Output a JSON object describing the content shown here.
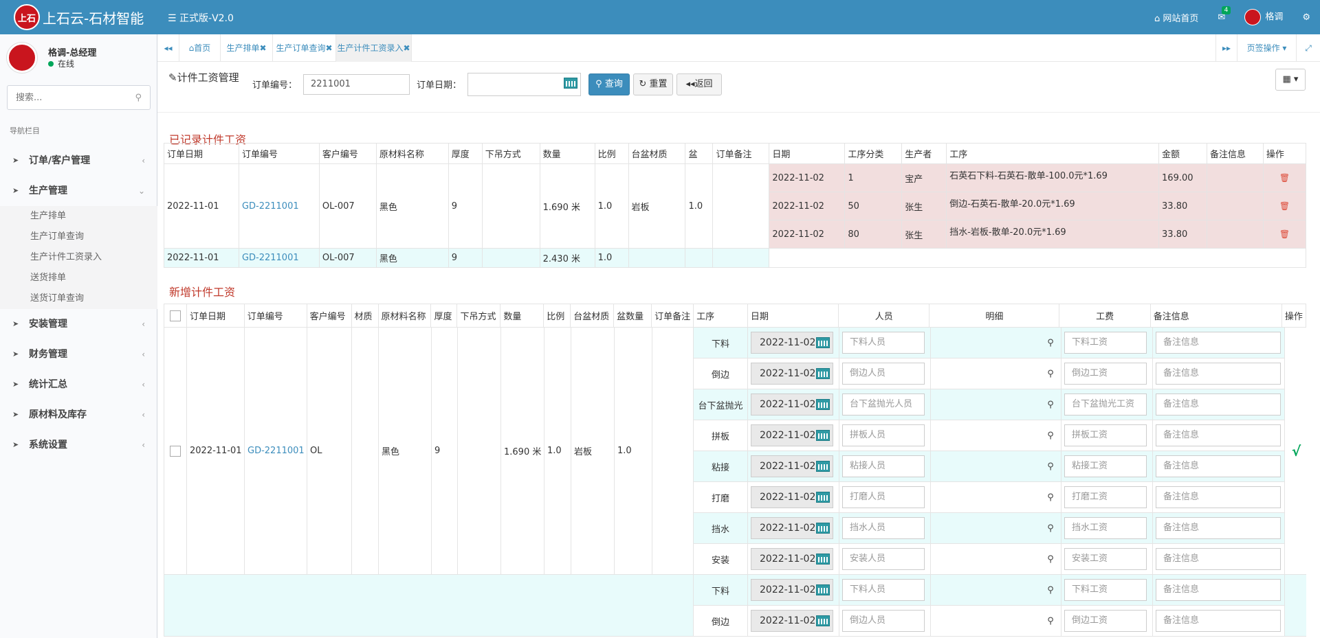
{
  "app": {
    "title": "上石云-石材智能",
    "logo_text": "上石",
    "version_label": "正式版-V2.0"
  },
  "topnav": {
    "home_label": "网站首页",
    "mail_badge": "4",
    "user_name": "格调"
  },
  "sidebar": {
    "user_name": "格调-总经理",
    "status": "在线",
    "search_placeholder": "搜索...",
    "nav_header": "导航栏目",
    "menu": [
      {
        "label": "订单/客户管理",
        "chev": "‹"
      },
      {
        "label": "生产管理",
        "chev": "⌄"
      },
      {
        "label": "安装管理",
        "chev": "‹"
      },
      {
        "label": "财务管理",
        "chev": "‹"
      },
      {
        "label": "统计汇总",
        "chev": "‹"
      },
      {
        "label": "原材料及库存",
        "chev": "‹"
      },
      {
        "label": "系统设置",
        "chev": "‹"
      }
    ],
    "submenu": [
      "生产排单",
      "生产订单查询",
      "生产计件工资录入",
      "送货排单",
      "送货订单查询"
    ]
  },
  "tabs": {
    "home": "首页",
    "t1": "生产排单",
    "t2": "生产订单查询",
    "t3": "生产计件工资录入",
    "page_ops": "页签操作"
  },
  "filter": {
    "title": "计件工资管理",
    "order_no_label": "订单编号：",
    "order_no_value": "2211001",
    "order_date_label": "订单日期：",
    "query_btn": "查询",
    "reset_btn": "重置",
    "back_btn": "返回"
  },
  "recorded": {
    "title": "已记录计件工资",
    "headers": [
      "订单日期",
      "订单编号",
      "客户编号",
      "原材料名称",
      "厚度",
      "下吊方式",
      "数量",
      "比例",
      "台盆材质",
      "盆",
      "订单备注",
      "日期",
      "工序分类",
      "生产者",
      "工序",
      "金额",
      "备注信息",
      "操作"
    ],
    "row1": {
      "order_date": "2022-11-01",
      "order_no": "GD-2211001",
      "cust": "OL-007",
      "material": "黑色",
      "thick": "9",
      "hang": "",
      "qty": "1.690 米",
      "ratio": "1.0",
      "basin_mat": "岩板",
      "basin": "1.0",
      "remark": ""
    },
    "entries": [
      {
        "date": "2022-11-02",
        "cat": "1",
        "worker": "宝产",
        "proc": "石英石下料-石英石-散单-100.0元*1.69",
        "amount": "169.00"
      },
      {
        "date": "2022-11-02",
        "cat": "50",
        "worker": "张生",
        "proc": "倒边-石英石-散单-20.0元*1.69",
        "amount": "33.80"
      },
      {
        "date": "2022-11-02",
        "cat": "80",
        "worker": "张生",
        "proc": "挡水-岩板-散单-20.0元*1.69",
        "amount": "33.80"
      }
    ],
    "row2": {
      "order_date": "2022-11-01",
      "order_no": "GD-2211001",
      "cust": "OL-007",
      "material": "黑色",
      "thick": "9",
      "qty": "2.430 米",
      "ratio": "1.0"
    }
  },
  "new": {
    "title": "新增计件工资",
    "headers": [
      "订单日期",
      "订单编号",
      "客户编号",
      "材质",
      "原材料名称",
      "厚度",
      "下吊方式",
      "数量",
      "比例",
      "台盆材质",
      "盆数量",
      "订单备注",
      "工序",
      "日期",
      "人员",
      "明细",
      "工费",
      "备注信息",
      "操作"
    ],
    "row": {
      "order_date": "2022-11-01",
      "order_no": "GD-2211001",
      "cust": "OL",
      "material": "黑色",
      "thick": "9",
      "qty": "1.690 米",
      "ratio": "1.0",
      "basin_mat": "岩板",
      "basin_qty": "1.0",
      "check": "√"
    },
    "processes": [
      {
        "name": "下料",
        "date": "2022-11-02",
        "person_ph": "下料人员",
        "fee_ph": "下料工资",
        "note_ph": "备注信息"
      },
      {
        "name": "倒边",
        "date": "2022-11-02",
        "person_ph": "倒边人员",
        "fee_ph": "倒边工资",
        "note_ph": "备注信息"
      },
      {
        "name": "台下盆抛光",
        "date": "2022-11-02",
        "person_ph": "台下盆抛光人员",
        "fee_ph": "台下盆抛光工资",
        "note_ph": "备注信息"
      },
      {
        "name": "拼板",
        "date": "2022-11-02",
        "person_ph": "拼板人员",
        "fee_ph": "拼板工资",
        "note_ph": "备注信息"
      },
      {
        "name": "粘接",
        "date": "2022-11-02",
        "person_ph": "粘接人员",
        "fee_ph": "粘接工资",
        "note_ph": "备注信息"
      },
      {
        "name": "打磨",
        "date": "2022-11-02",
        "person_ph": "打磨人员",
        "fee_ph": "打磨工资",
        "note_ph": "备注信息"
      },
      {
        "name": "挡水",
        "date": "2022-11-02",
        "person_ph": "挡水人员",
        "fee_ph": "挡水工资",
        "note_ph": "备注信息"
      },
      {
        "name": "安装",
        "date": "2022-11-02",
        "person_ph": "安装人员",
        "fee_ph": "安装工资",
        "note_ph": "备注信息"
      }
    ],
    "processes2": [
      {
        "name": "下料",
        "date": "2022-11-02",
        "person_ph": "下料人员",
        "fee_ph": "下料工资",
        "note_ph": "备注信息"
      },
      {
        "name": "倒边",
        "date": "2022-11-02",
        "person_ph": "倒边人员",
        "fee_ph": "倒边工资",
        "note_ph": "备注信息"
      }
    ]
  }
}
